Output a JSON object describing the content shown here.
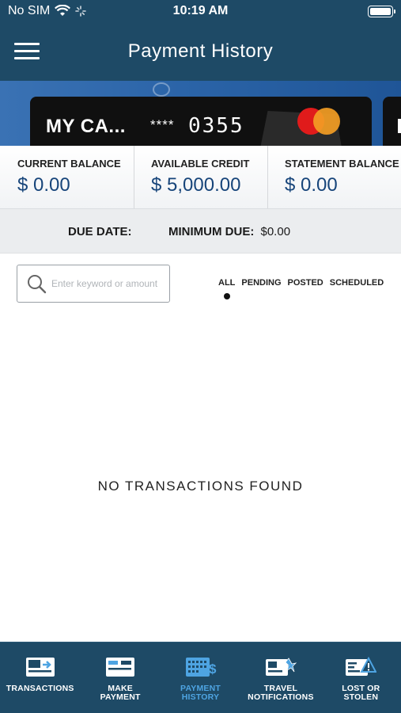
{
  "status_bar": {
    "carrier": "No SIM",
    "time": "10:19 AM"
  },
  "header": {
    "title": "Payment History"
  },
  "card": {
    "name": "MY CA...",
    "mask": "****",
    "last4": "0355"
  },
  "balances": [
    {
      "label": "CURRENT BALANCE",
      "value": "$ 0.00"
    },
    {
      "label": "AVAILABLE CREDIT",
      "value": "$ 5,000.00"
    },
    {
      "label": "STATEMENT BALANCE",
      "value": "$ 0.00"
    }
  ],
  "due": {
    "due_date_label": "DUE DATE:",
    "min_due_label": "MINIMUM DUE:",
    "min_due_value": "$0.00"
  },
  "search": {
    "placeholder": "Enter keyword or amount"
  },
  "filters": {
    "selected": "ALL",
    "items": [
      "ALL",
      "PENDING",
      "POSTED",
      "SCHEDULED"
    ]
  },
  "empty_message": "NO TRANSACTIONS FOUND",
  "bottom_nav": {
    "active": "PAYMENT HISTORY",
    "items": [
      {
        "label": "TRANSACTIONS",
        "icon": "transactions-icon"
      },
      {
        "label": "MAKE\nPAYMENT",
        "icon": "make-payment-icon"
      },
      {
        "label": "PAYMENT\nHISTORY",
        "icon": "payment-history-icon"
      },
      {
        "label": "TRAVEL\nNOTIFICATIONS",
        "icon": "travel-notifications-icon"
      },
      {
        "label": "LOST OR\nSTOLEN",
        "icon": "lost-or-stolen-icon"
      }
    ]
  },
  "colors": {
    "header": "#1e4a66",
    "balance_text": "#17457a",
    "active_nav": "#4ea4e2"
  }
}
